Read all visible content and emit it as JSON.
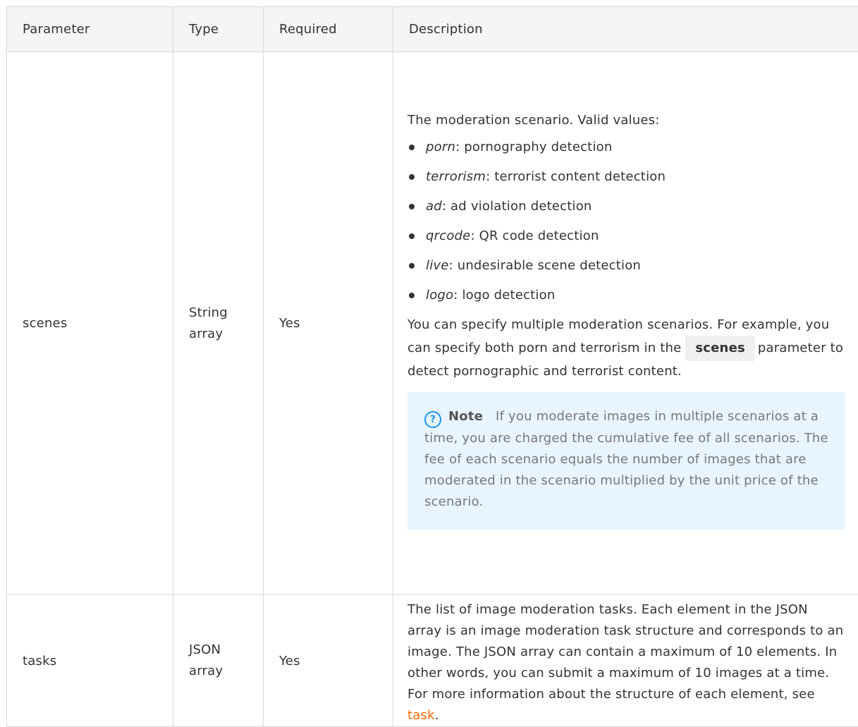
{
  "table": {
    "headers": {
      "parameter": "Parameter",
      "type": "Type",
      "required": "Required",
      "description": "Description"
    },
    "rows": [
      {
        "parameter": "scenes",
        "type_line1": "String",
        "type_line2": "array",
        "required": "Yes",
        "intro": "The moderation scenario. Valid values:",
        "values": [
          {
            "key": "porn",
            "desc": ": pornography detection"
          },
          {
            "key": "terrorism",
            "desc": ": terrorist content detection"
          },
          {
            "key": "ad",
            "desc": ": ad violation detection"
          },
          {
            "key": "qrcode",
            "desc": ": QR code detection"
          },
          {
            "key": "live",
            "desc": ": undesirable scene detection"
          },
          {
            "key": "logo",
            "desc": ": logo detection"
          }
        ],
        "multi_text_before": "You can specify multiple moderation scenarios. For example, you can specify both porn and terrorism in the",
        "code": "scenes",
        "multi_text_after": "parameter to detect pornographic and terrorist content.",
        "note": {
          "icon": "question-circle-icon",
          "label": "Note",
          "text": "If you moderate images in multiple scenarios at a time, you are charged the cumulative fee of all scenarios. The fee of each scenario equals the number of images that are moderated in the scenario multiplied by the unit price of the scenario."
        }
      },
      {
        "parameter": "tasks",
        "type_line1": "JSON",
        "type_line2": "array",
        "required": "Yes",
        "description_text": "The list of image moderation tasks. Each element in the JSON array is an image moderation task structure and corresponds to an image. The JSON array can contain a maximum of 10 elements. In other words, you can submit a maximum of 10 images at a time. For more information about the structure of each element, see",
        "link": "task",
        "trailing": "."
      }
    ]
  },
  "colors": {
    "border": "#d9d9d9",
    "header_bg": "#f5f5f5",
    "note_bg": "#e8f5ff",
    "note_icon": "#1b97e6",
    "link": "#ff6a00",
    "text": "#333333"
  }
}
